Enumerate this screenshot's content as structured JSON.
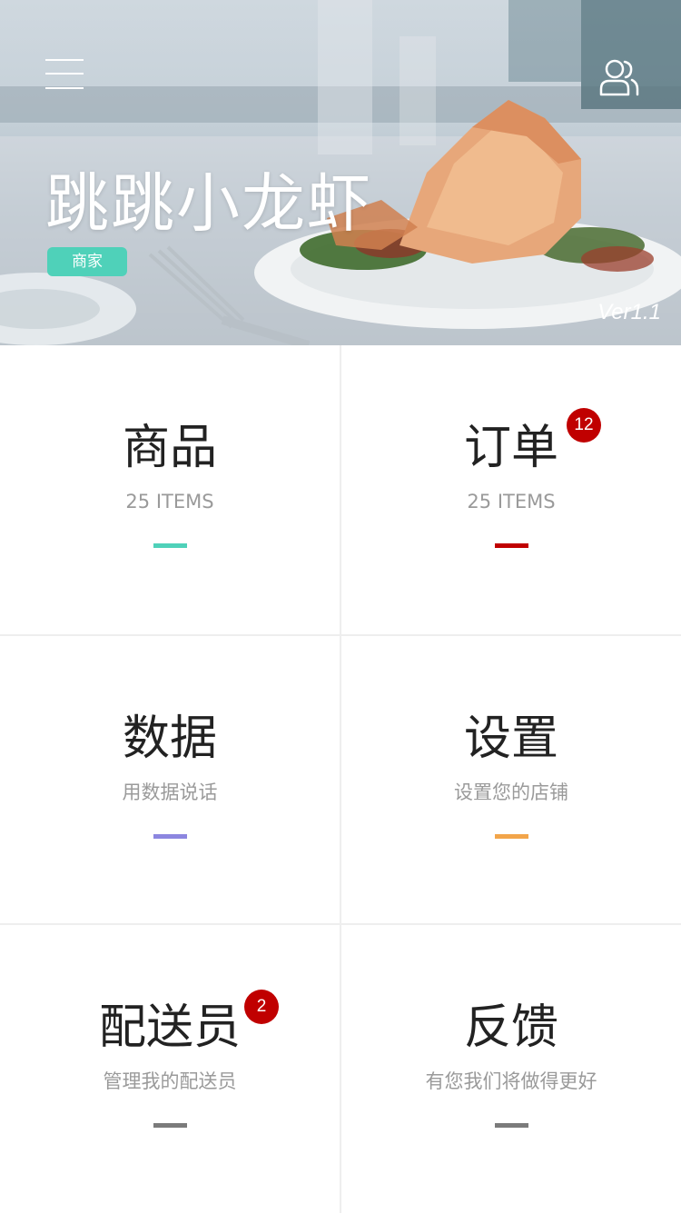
{
  "header": {
    "store_name": "跳跳小龙虾",
    "role_badge": "商家",
    "version": "Ver1.1",
    "menu_icon": "hamburger-menu-icon",
    "user_icon": "users-icon"
  },
  "tiles": [
    {
      "title": "商品",
      "subtitle": "25 ITEMS",
      "accent_color": "#4fd1b9"
    },
    {
      "title": "订单",
      "subtitle": "25 ITEMS",
      "accent_color": "#c00000",
      "badge": "12"
    },
    {
      "title": "数据",
      "subtitle": "用数据说话",
      "accent_color": "#8c86e0"
    },
    {
      "title": "设置",
      "subtitle": "设置您的店铺",
      "accent_color": "#f2a54a"
    },
    {
      "title": "配送员",
      "subtitle": "管理我的配送员",
      "accent_color": "#7b7b7b",
      "badge": "2"
    },
    {
      "title": "反馈",
      "subtitle": "有您我们将做得更好",
      "accent_color": "#7b7b7b"
    }
  ],
  "colors": {
    "badge_bg": "#c00000",
    "role_badge_bg": "#4fd1b9",
    "divider": "#eeeeee",
    "title_text": "#222222",
    "subtitle_text": "#9a9a9a"
  }
}
